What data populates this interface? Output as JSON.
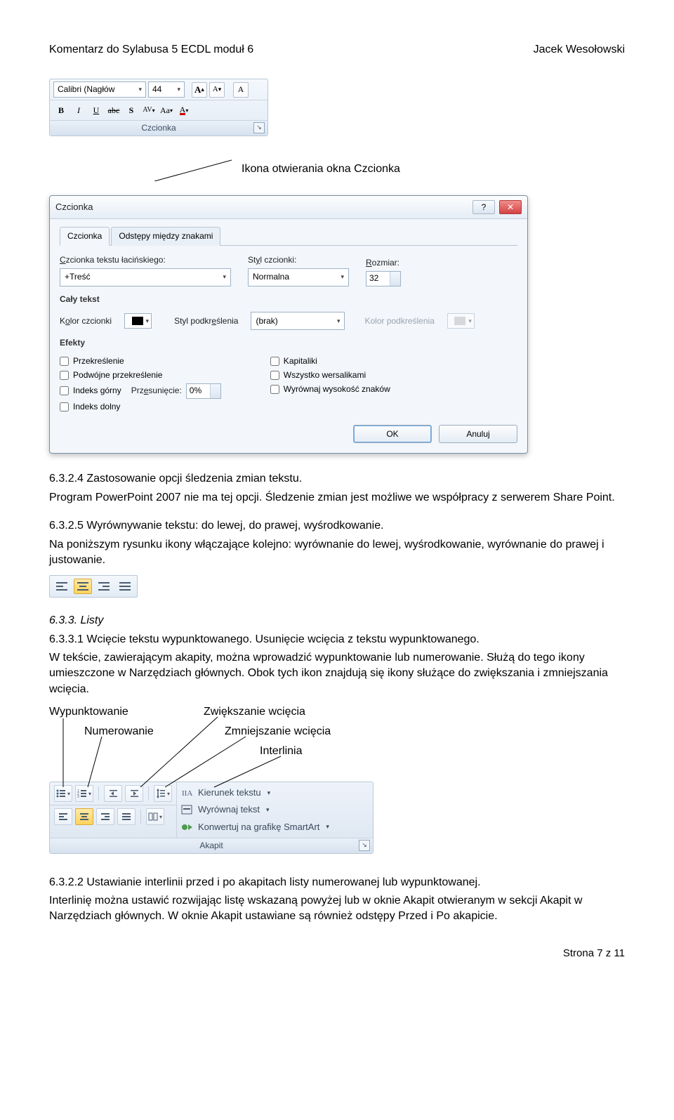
{
  "header": {
    "left": "Komentarz do Sylabusa 5 ECDL moduł 6",
    "right": "Jacek Wesołowski"
  },
  "callout_font": "Ikona otwierania okna Czcionka",
  "ribbon_font": {
    "font_name": "Calibri (Nagłów",
    "font_size": "44",
    "grow": "A",
    "shrink": "A",
    "clear": "A",
    "bold": "B",
    "italic": "I",
    "underline": "U",
    "strike": "abc",
    "shadow": "S",
    "spacing": "AV",
    "case": "Aa",
    "color": "A",
    "group_title": "Czcionka"
  },
  "dialog": {
    "title": "Czcionka",
    "tab_font": "Czcionka",
    "tab_spacing": "Odstępy między znakami",
    "latin_label": "Czcionka tekstu łacińskiego:",
    "latin_value": "+Treść",
    "style_label": "Styl czcionki:",
    "style_value": "Normalna",
    "size_label": "Rozmiar:",
    "size_value": "32",
    "all_text": "Cały tekst",
    "font_color": "Kolor czcionki",
    "underline_style": "Styl podkreślenia",
    "underline_value": "(brak)",
    "underline_color": "Kolor podkreślenia",
    "effects": "Efekty",
    "fx_strike": "Przekreślenie",
    "fx_dblstrike": "Podwójne przekreślenie",
    "fx_super": "Indeks górny",
    "fx_sub": "Indeks dolny",
    "offset_label": "Przesunięcie:",
    "offset_value": "0%",
    "fx_smallcaps": "Kapitaliki",
    "fx_allcaps": "Wszystko wersalikami",
    "fx_equalize": "Wyrównaj wysokość znaków",
    "ok": "OK",
    "cancel": "Anuluj"
  },
  "body": {
    "h_624": "6.3.2.4 Zastosowanie opcji śledzenia zmian tekstu.",
    "p_624a": "Program PowerPoint 2007 nie ma tej opcji. Śledzenie zmian jest możliwe we współpracy z serwerem Share Point.",
    "h_625": "6.3.2.5 Wyrównywanie tekstu: do lewej, do prawej, wyśrodkowanie.",
    "p_625a": "Na poniższym rysunku ikony włączające kolejno: wyrównanie do lewej, wyśrodkowanie, wyrównanie do prawej i justowanie.",
    "h_633": "6.3.3. Listy",
    "h_6331": "6.3.3.1 Wcięcie tekstu wypunktowanego. Usunięcie wcięcia z tekstu wypunktowanego.",
    "p_6331a": "W tekście, zawierającym akapity, można wprowadzić wypunktowanie lub numerowanie. Służą do tego ikony umieszczone w Narzędziach głównych. Obok tych ikon znajdują się ikony służące do zwiększania i zmniejszania wcięcia.",
    "lab_bullets": "Wypunktowanie",
    "lab_numbering": "Numerowanie",
    "lab_inc": "Zwiększanie wcięcia",
    "lab_dec": "Zmniejszanie wcięcia",
    "lab_spacing": "Interlinia",
    "h_6322": "6.3.2.2 Ustawianie interlinii przed i po akapitach listy numerowanej lub wypunktowanej.",
    "p_6322a": "Interlinię można ustawić rozwijając listę wskazaną powyżej lub w oknie Akapit otwieranym w sekcji Akapit w Narzędziach głównych. W oknie Akapit ustawiane są również odstępy Przed i Po akapicie."
  },
  "para_ribbon": {
    "text_direction": "Kierunek tekstu",
    "align_text": "Wyrównaj tekst",
    "convert_smart": "Konwertuj na grafikę SmartArt",
    "group_title": "Akapit"
  },
  "footer": "Strona 7 z 11"
}
